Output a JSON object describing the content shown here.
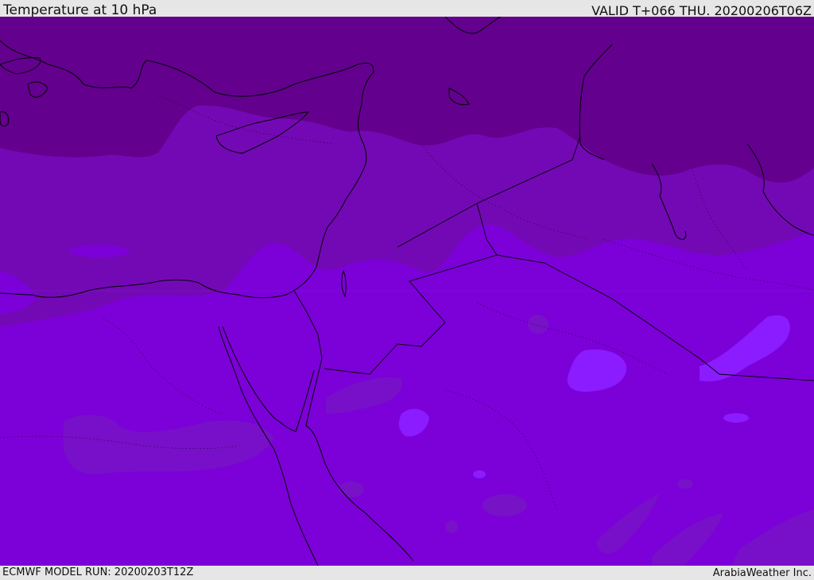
{
  "header": {
    "title": "Temperature at 10 hPa",
    "valid_time": "VALID T+066 THU. 20200206T06Z"
  },
  "footer": {
    "model_run": "ECMWF MODEL RUN: 20200203T12Z",
    "credit": "ArabiaWeather Inc."
  },
  "map": {
    "colors": {
      "coldest_band": "#63008e",
      "cold_band": "#7309b4",
      "base_band": "#7c00d8",
      "mid_band": "#7712c7",
      "warm_patch": "#8a1cff",
      "warmest_patch": "#9a2bff",
      "coastline": "#000000"
    }
  }
}
